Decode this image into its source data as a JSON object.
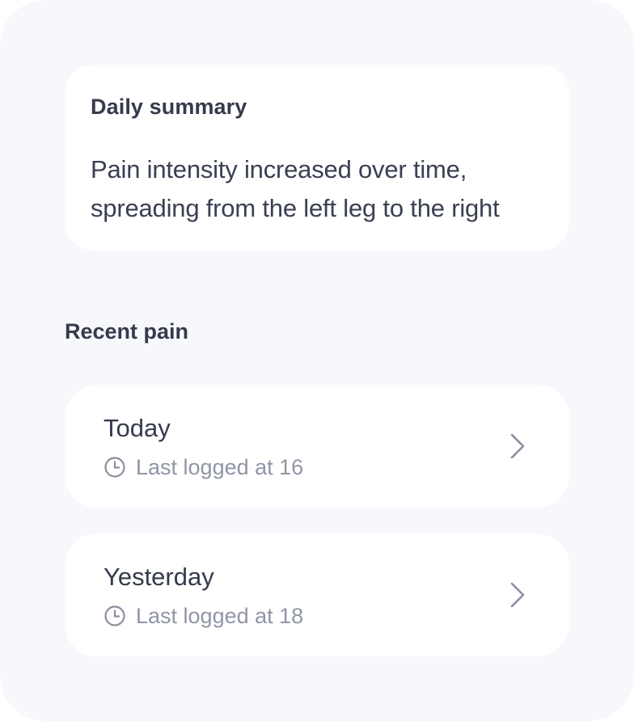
{
  "summary": {
    "title": "Daily summary",
    "text_line1": "Pain intensity increased over time,",
    "text_line2": "spreading from the left leg to the right"
  },
  "recent": {
    "title": "Recent pain",
    "entries": [
      {
        "day": "Today",
        "meta": "Last logged at 16",
        "icon": "clock-icon",
        "action_icon": "chevron-right-icon"
      },
      {
        "day": "Yesterday",
        "meta": "Last logged at 18",
        "icon": "clock-icon",
        "action_icon": "chevron-right-icon"
      }
    ]
  },
  "colors": {
    "background": "#f7f8fc",
    "card": "#ffffff",
    "text_primary": "#353b4b",
    "text_secondary": "#9095a5",
    "icon": "#8a90a0"
  }
}
